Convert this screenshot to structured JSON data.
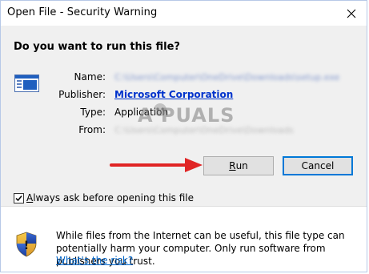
{
  "window": {
    "title": "Open File - Security Warning"
  },
  "dialog": {
    "question": "Do you want to run this file?",
    "fields": {
      "name_label": "Name:",
      "name_value": "C:\\Users\\Computer\\OneDrive\\Downloads\\setup.exe",
      "publisher_label": "Publisher:",
      "publisher_value": "Microsoft Corporation",
      "type_label": "Type:",
      "type_value": "Application",
      "from_label": "From:",
      "from_value": "C:\\Users\\Computer\\OneDrive\\Downloads"
    },
    "watermark": "A PUALS",
    "buttons": {
      "run_label_underlined": "R",
      "run_label_rest": "un",
      "cancel_label": "Cancel"
    },
    "checkbox": {
      "checked": true,
      "label_underlined": "A",
      "label_rest": "lways ask before opening this file"
    }
  },
  "footer": {
    "warning_text": "While files from the Internet can be useful, this file type can potentially harm your computer. Only run software from publishers you trust.",
    "risk_link": "What's the risk?"
  },
  "colors": {
    "dialog_bg": "#f0f0f0",
    "link_blue": "#0066cc",
    "publisher_blue": "#0033cc",
    "arrow_red": "#e02424",
    "focus_border": "#0078d7"
  },
  "icons": {
    "close": "close-icon",
    "file": "application-file-icon",
    "shield": "security-shield-icon",
    "check": "checkmark-icon"
  }
}
